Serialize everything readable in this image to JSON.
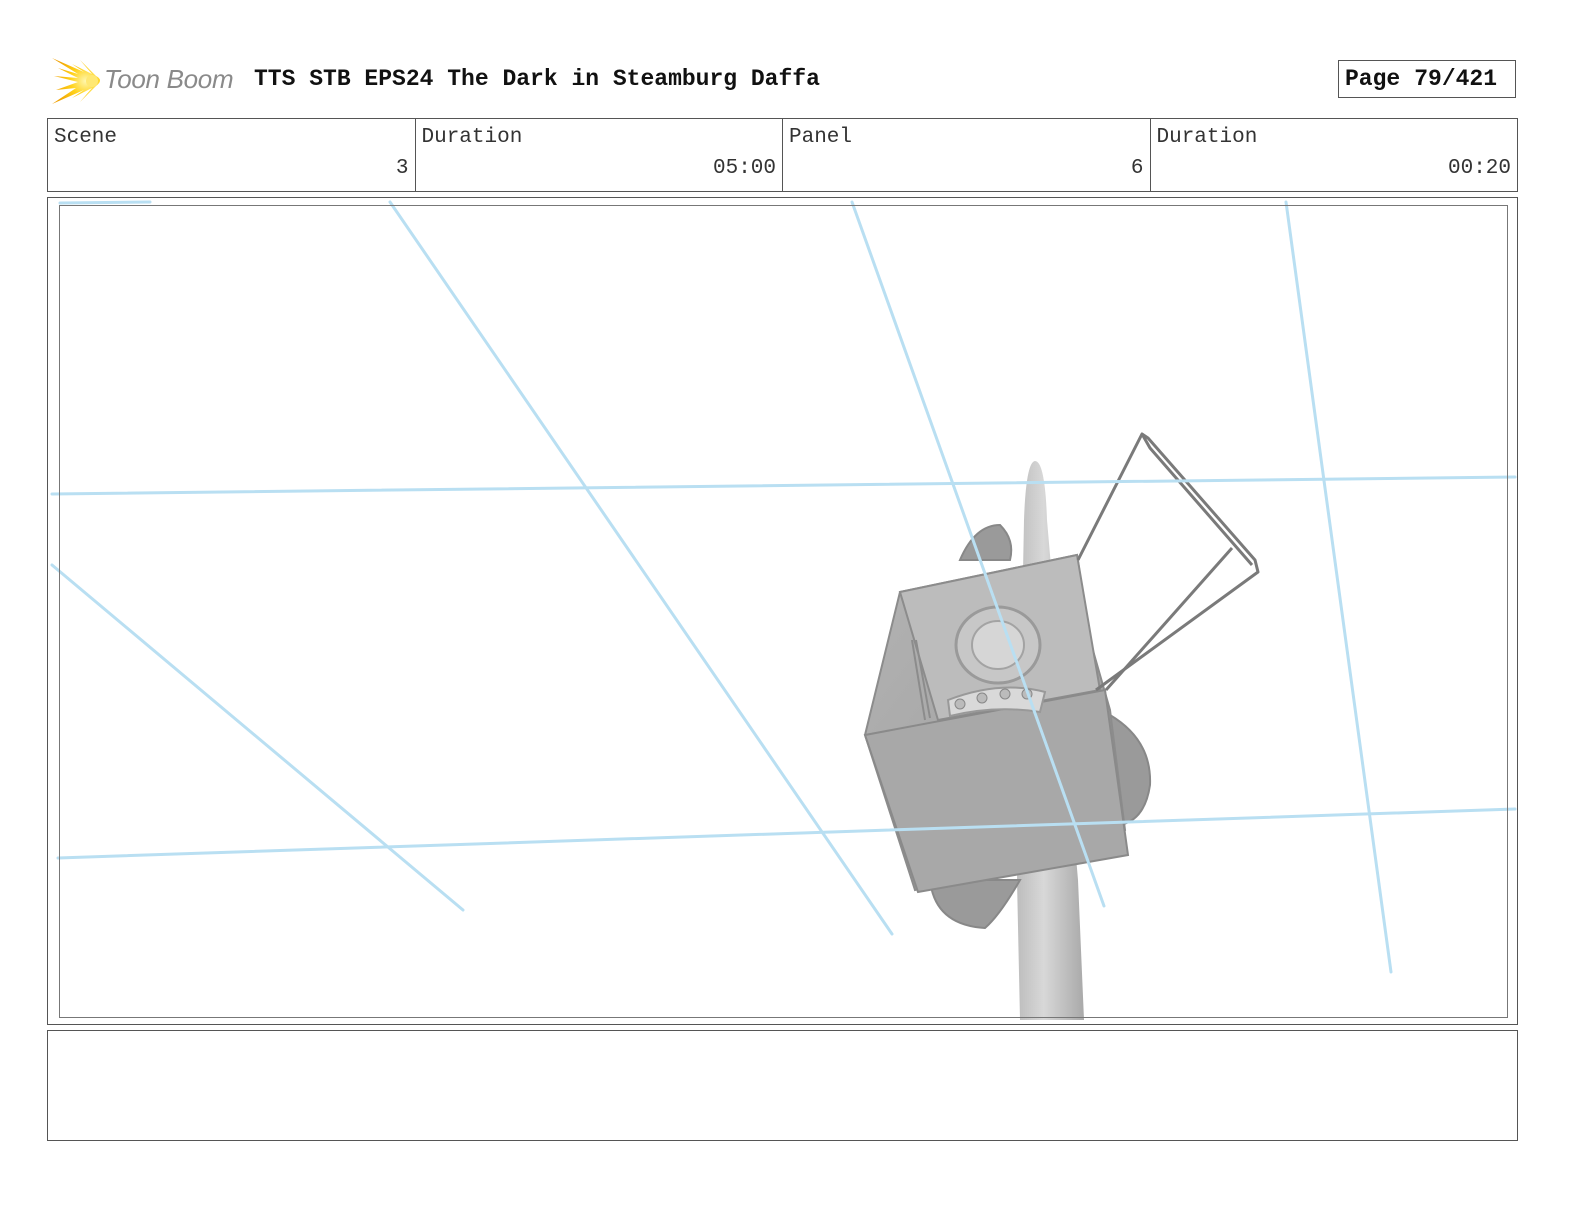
{
  "header": {
    "logo_text": "Toon Boom",
    "project_title": "TTS STB EPS24 The Dark in Steamburg Daffa",
    "page_label": "Page",
    "page_number": "79/421"
  },
  "info": {
    "scene_label": "Scene",
    "scene_value": "3",
    "scene_duration_label": "Duration",
    "scene_duration_value": "05:00",
    "panel_label": "Panel",
    "panel_value": "6",
    "panel_duration_label": "Duration",
    "panel_duration_value": "00:20"
  },
  "panel": {
    "guide_line_color": "#b9dff2",
    "model_color": "#a6a6a6"
  },
  "notes": {}
}
